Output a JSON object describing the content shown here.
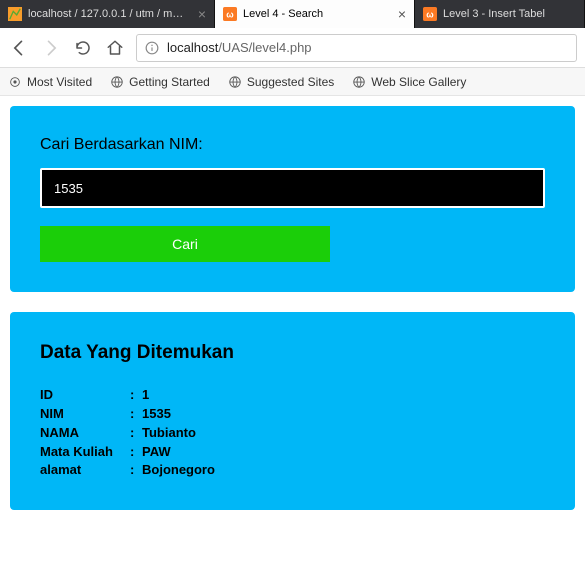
{
  "tabs": [
    {
      "label": "localhost / 127.0.0.1 / utm / m…",
      "active": false
    },
    {
      "label": "Level 4 - Search",
      "active": true
    },
    {
      "label": "Level 3 - Insert Tabel",
      "active": false
    }
  ],
  "urlbar": {
    "info_icon_desc": "info",
    "host": "localhost",
    "path": "/UAS/level4.php"
  },
  "bookmarks": [
    {
      "label": "Most Visited"
    },
    {
      "label": "Getting Started"
    },
    {
      "label": "Suggested Sites"
    },
    {
      "label": "Web Slice Gallery"
    }
  ],
  "form": {
    "label": "Cari Berdasarkan NIM:",
    "input_value": "1535",
    "button": "Cari"
  },
  "result": {
    "heading": "Data Yang Ditemukan",
    "rows": [
      {
        "key": "ID",
        "val": "1"
      },
      {
        "key": "NIM",
        "val": "1535"
      },
      {
        "key": "NAMA",
        "val": "Tubianto"
      },
      {
        "key": "Mata Kuliah",
        "val": "PAW"
      },
      {
        "key": "alamat",
        "val": "Bojonegoro"
      }
    ]
  }
}
